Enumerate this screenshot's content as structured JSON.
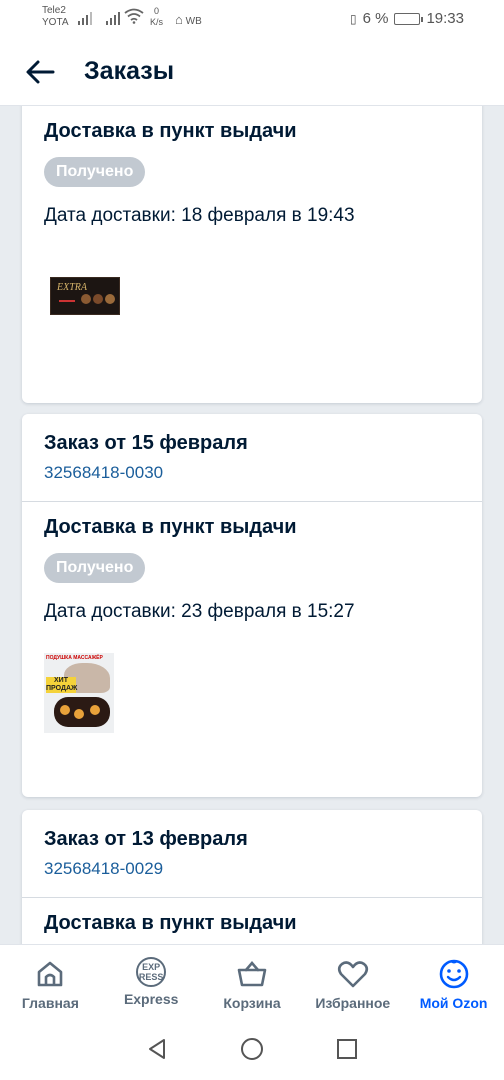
{
  "status_bar": {
    "carrier1": "Tele2",
    "carrier2": "YOTA",
    "speed_value": "0",
    "speed_unit": "K/s",
    "vpn": "WB",
    "battery": "6 %",
    "time": "19:33"
  },
  "header": {
    "title": "Заказы"
  },
  "orders": [
    {
      "shipment_title": "Доставка в пункт выдачи",
      "status": "Получено",
      "delivery_date": "Дата доставки: 18 февраля в 19:43",
      "thumb_text": "EXTRA"
    },
    {
      "order_title": "Заказ от 15 февраля",
      "order_number": "32568418-0030",
      "shipment_title": "Доставка в пункт выдачи",
      "status": "Получено",
      "delivery_date": "Дата доставки: 23 февраля в 15:27",
      "thumb_top": "ПОДУШКА МАССАЖЁР",
      "thumb_hit": "ХИТ ПРОДАЖ"
    },
    {
      "order_title": "Заказ от 13 февраля",
      "order_number": "32568418-0029",
      "shipment_title": "Доставка в пункт выдачи"
    }
  ],
  "bottom_nav": [
    {
      "label": "Главная",
      "icon": "home-icon"
    },
    {
      "label": "Express",
      "icon": "express-icon",
      "icon_text_top": "EXP",
      "icon_text_bottom": "RESS"
    },
    {
      "label": "Корзина",
      "icon": "basket-icon"
    },
    {
      "label": "Избранное",
      "icon": "heart-icon"
    },
    {
      "label": "Мой Ozon",
      "icon": "smile-icon",
      "active": true
    }
  ],
  "colors": {
    "accent": "#005bff",
    "text": "#001a34",
    "badge": "#c2c9d1",
    "link": "#1b5e9b"
  }
}
